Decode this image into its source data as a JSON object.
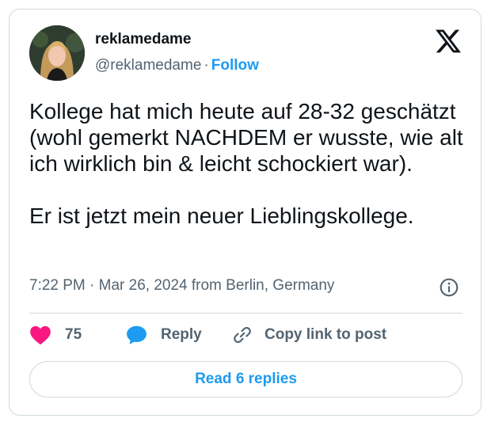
{
  "author": {
    "name": "reklamedame",
    "handle": "@reklamedame",
    "separator": "·",
    "follow_label": "Follow"
  },
  "tweet": {
    "paragraphs": [
      "Kollege hat mich heute auf 28-32 geschätzt (wohl gemerkt NACHDEM er wusste, wie alt ich wirklich bin & leicht schockiert war).",
      "Er ist jetzt mein neuer Lieblingskollege."
    ],
    "timestamp": "7:22 PM · Mar 26, 2024 from Berlin, Germany"
  },
  "actions": {
    "like_count": "75",
    "reply_label": "Reply",
    "copy_label": "Copy link to post"
  },
  "read_replies_label": "Read 6 replies",
  "colors": {
    "accent": "#1d9bf0",
    "heart": "#f91880",
    "text": "#0f1419",
    "muted": "#536471",
    "border": "#cfd9de"
  },
  "icons": {
    "logo": "x-logo-icon",
    "info": "info-icon",
    "like": "heart-icon",
    "reply": "speech-bubble-icon",
    "copy": "link-icon"
  }
}
